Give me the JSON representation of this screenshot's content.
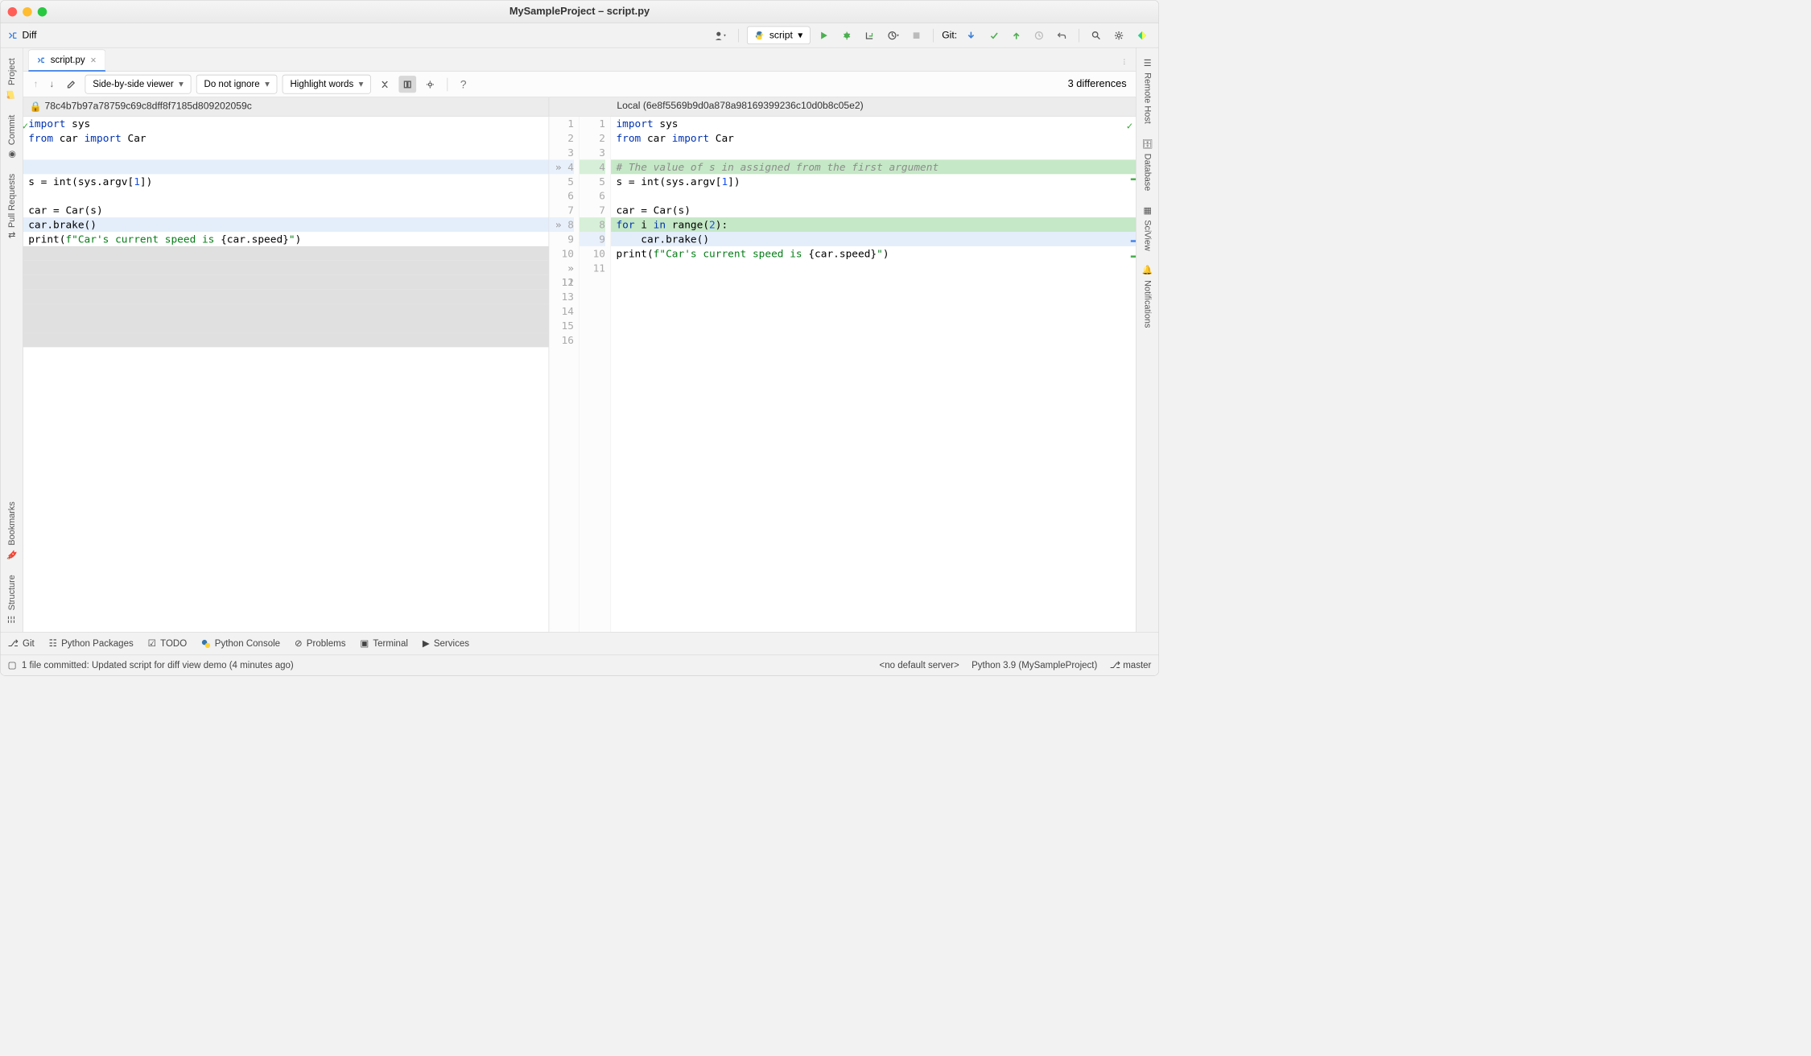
{
  "window": {
    "title": "MySampleProject – script.py"
  },
  "toolbar": {
    "diff_label": "Diff",
    "run_config": "script",
    "git_label": "Git:"
  },
  "left_tabs": [
    "Project",
    "Commit",
    "Pull Requests",
    "Bookmarks",
    "Structure"
  ],
  "right_tabs": [
    "Remote Host",
    "Database",
    "SciView",
    "Notifications"
  ],
  "file_tab": {
    "name": "script.py"
  },
  "diff_toolbar": {
    "viewer_mode": "Side-by-side viewer",
    "ignore_mode": "Do not ignore",
    "highlight_mode": "Highlight words",
    "diff_count": "3 differences"
  },
  "headers": {
    "left_rev": "78c4b7b97a78759c69c8dff8f7185d809202059c",
    "right_label": "Local (6e8f5569b9d0a878a98169399236c10d0b8c05e2)"
  },
  "left_code": [
    {
      "n": 1,
      "t": "import",
      "html": "<span class='kw'>import</span> sys"
    },
    {
      "n": 2,
      "html": "<span class='kw'>from</span> car <span class='kw'>import</span> Car"
    },
    {
      "n": 3,
      "html": ""
    },
    {
      "n": 4,
      "html": "",
      "cls": "bg-blue",
      "gcls": "bg-blueg",
      "chev": true
    },
    {
      "n": 5,
      "html": "s = int(sys.argv[<span class='num'>1</span>])"
    },
    {
      "n": 6,
      "html": ""
    },
    {
      "n": 7,
      "html": "car = Car(s)"
    },
    {
      "n": 8,
      "html": "car.brake()",
      "cls": "bg-blue",
      "gcls": "bg-blueg",
      "chev": true
    },
    {
      "n": 9,
      "html": "print(<span class='str'>f\"Car's current speed is </span>{car.speed}<span class='str'>\"</span>)"
    },
    {
      "n": 10,
      "html": "",
      "cls": "bg-grey"
    },
    {
      "n": 11,
      "html": "",
      "cls": "bg-grey",
      "chev": true
    },
    {
      "n": 12,
      "html": "",
      "cls": "bg-grey"
    },
    {
      "n": 13,
      "html": "",
      "cls": "bg-grey"
    },
    {
      "n": 14,
      "html": "",
      "cls": "bg-grey"
    },
    {
      "n": 15,
      "html": "",
      "cls": "bg-grey"
    },
    {
      "n": 16,
      "html": "",
      "cls": "bg-grey"
    }
  ],
  "right_code": [
    {
      "n": 1,
      "html": "<span class='kw'>import</span> sys"
    },
    {
      "n": 2,
      "html": "<span class='kw'>from</span> car <span class='kw'>import</span> Car"
    },
    {
      "n": 3,
      "html": ""
    },
    {
      "n": 4,
      "html": "<span class='com'># The value of s in assigned from the first argument</span>",
      "cls": "bg-green",
      "gcls": "bg-greeng"
    },
    {
      "n": 5,
      "html": "s = int(sys.argv[<span class='num'>1</span>])"
    },
    {
      "n": 6,
      "html": ""
    },
    {
      "n": 7,
      "html": "car = Car(s)"
    },
    {
      "n": 8,
      "html": "<span class='kw'>for</span> i <span class='kw'>in</span> range(<span class='num'>2</span>):",
      "cls": "bg-green",
      "gcls": "bg-greeng"
    },
    {
      "n": 9,
      "html": "    car.brake()",
      "cls": "bg-blue",
      "gcls": "bg-blueg"
    },
    {
      "n": 10,
      "html": "print(<span class='str'>f\"Car's current speed is </span>{car.speed}<span class='str'>\"</span>)"
    },
    {
      "n": 11,
      "html": ""
    }
  ],
  "bottom_items": [
    "Git",
    "Python Packages",
    "TODO",
    "Python Console",
    "Problems",
    "Terminal",
    "Services"
  ],
  "status": {
    "msg": "1 file committed: Updated script for diff view demo (4 minutes ago)",
    "server": "<no default server>",
    "interpreter": "Python 3.9 (MySampleProject)",
    "branch": "master"
  }
}
